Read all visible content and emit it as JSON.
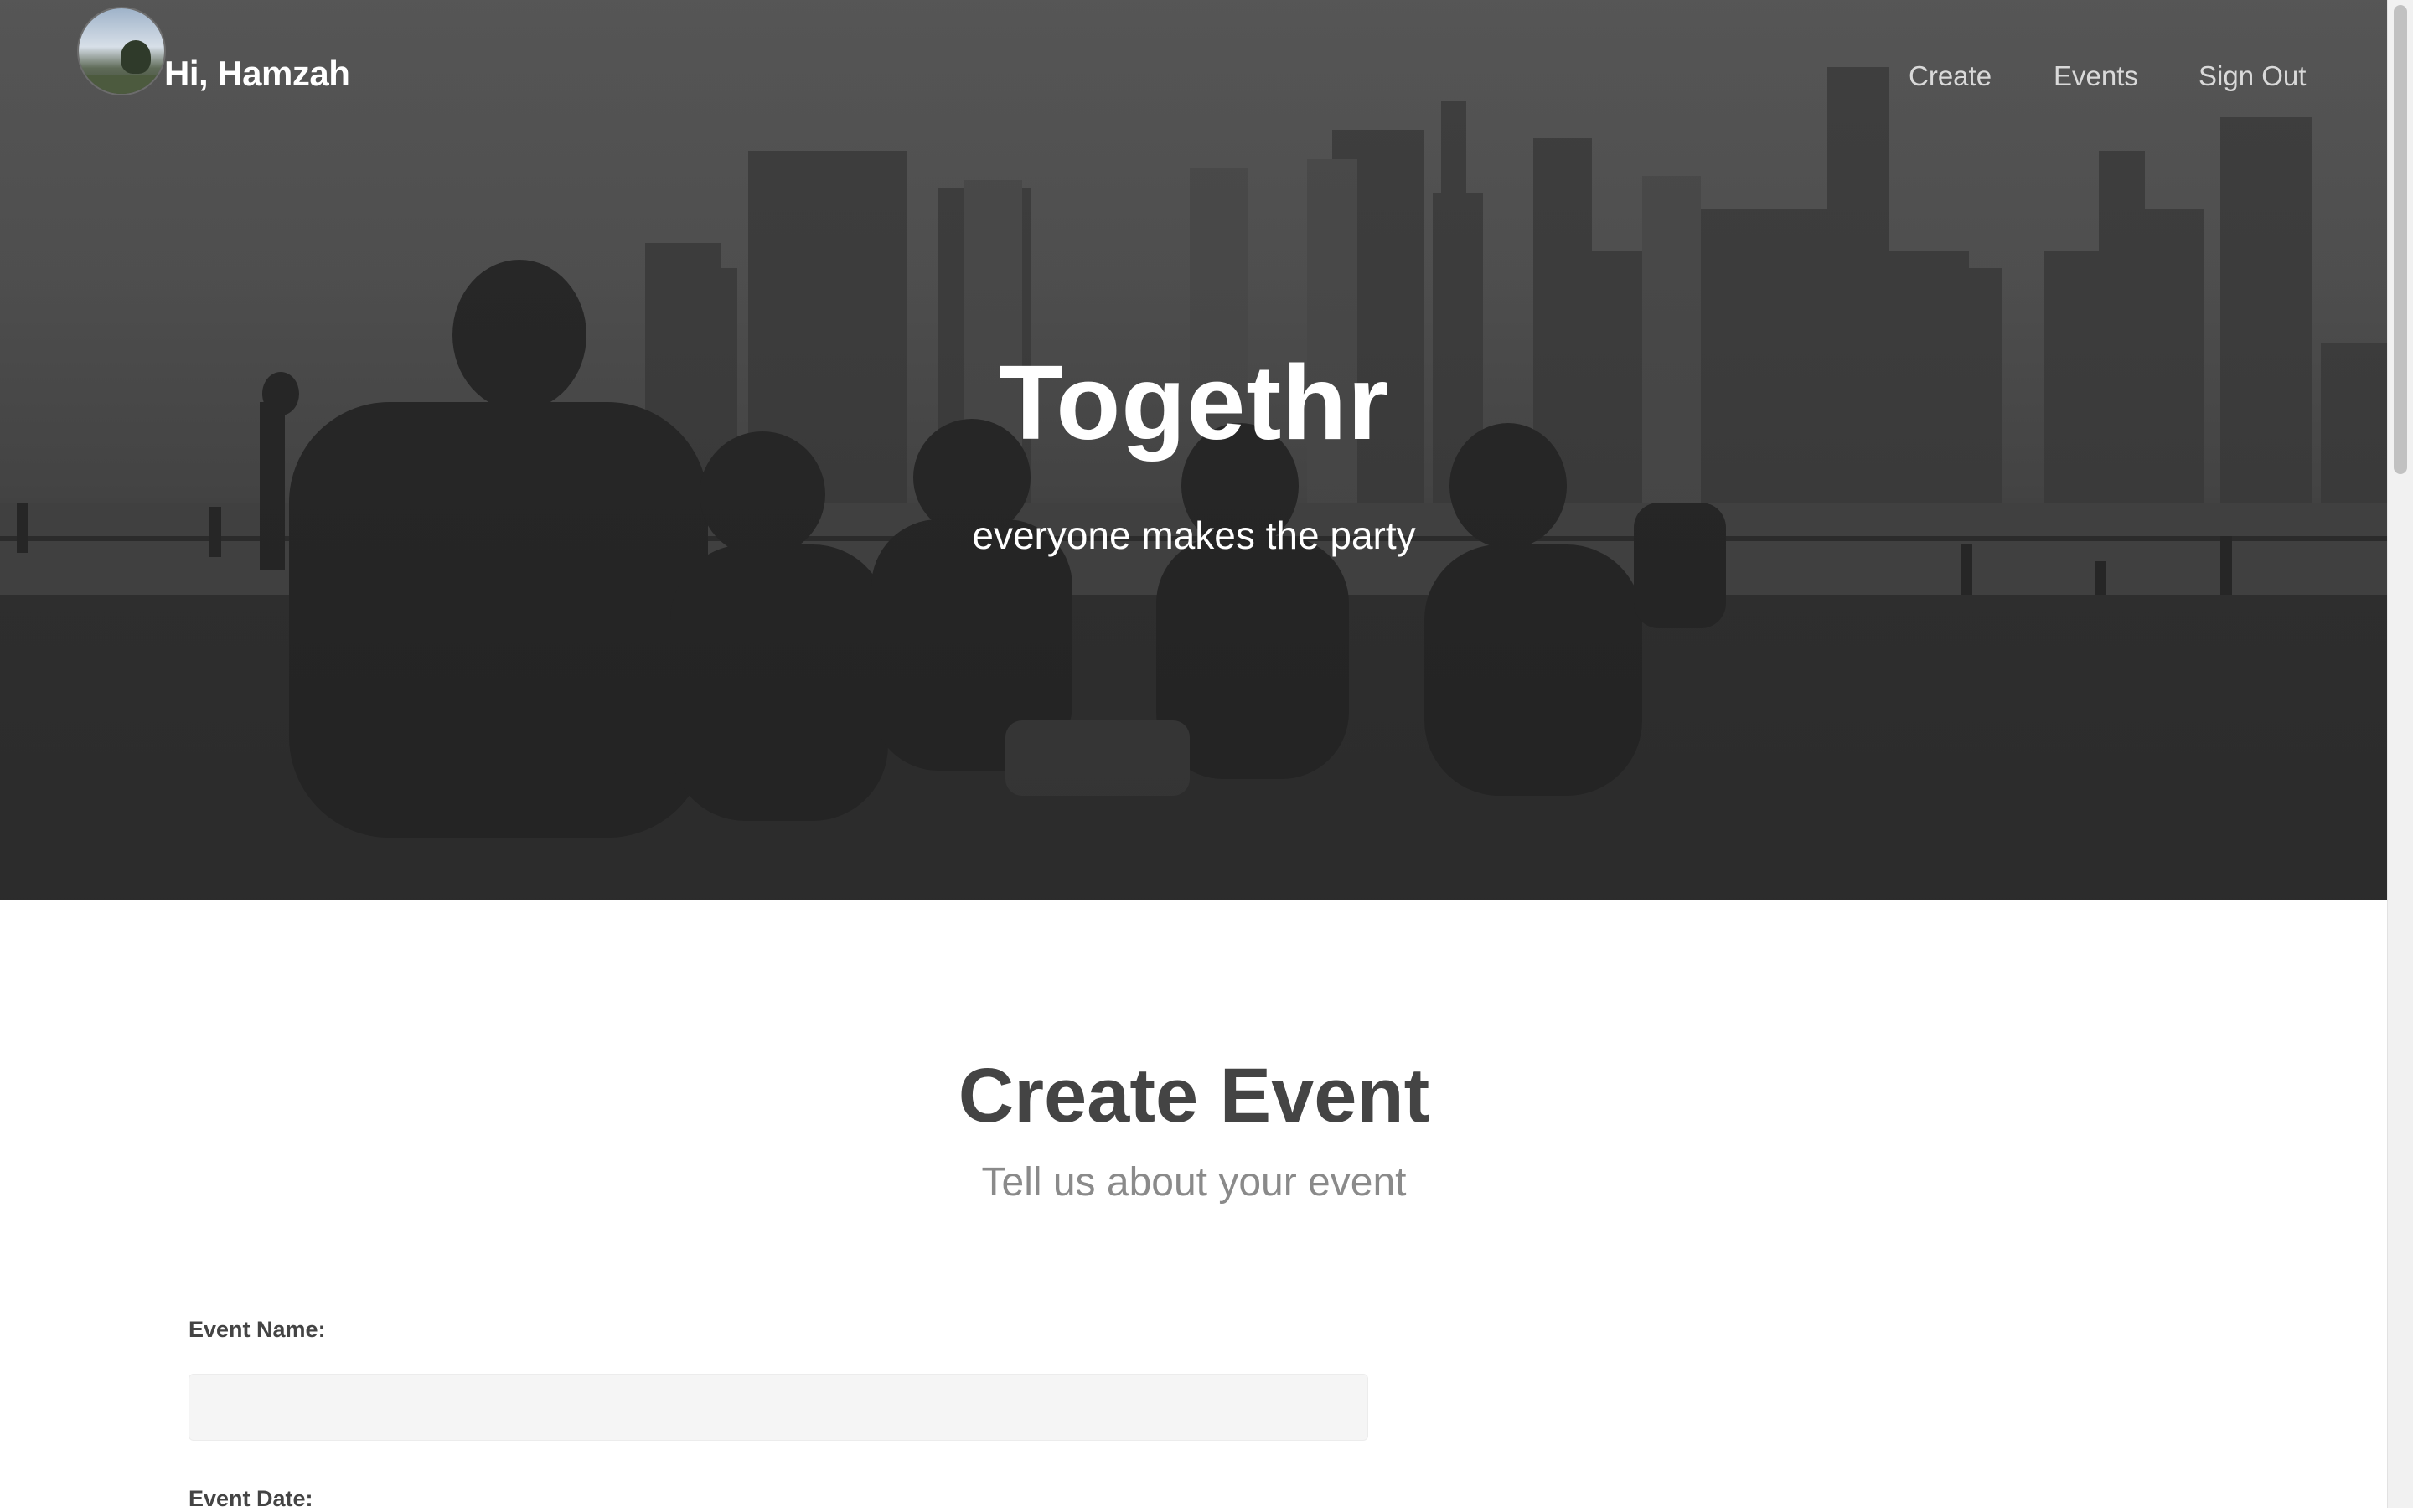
{
  "header": {
    "greeting": "Hi, Hamzah",
    "nav": {
      "create": "Create",
      "events": "Events",
      "sign_out": "Sign Out"
    }
  },
  "hero": {
    "title": "Togethr",
    "tagline": "everyone makes the party"
  },
  "form": {
    "title": "Create Event",
    "subtitle": "Tell us about your event",
    "event_name_label": "Event Name:",
    "event_name_value": "",
    "event_date_label": "Event Date:"
  },
  "colors": {
    "hero_overlay": "#4a4a4a",
    "heading_text": "#444444",
    "subheading_text": "#8a8a8a",
    "input_background": "#f5f5f5"
  }
}
